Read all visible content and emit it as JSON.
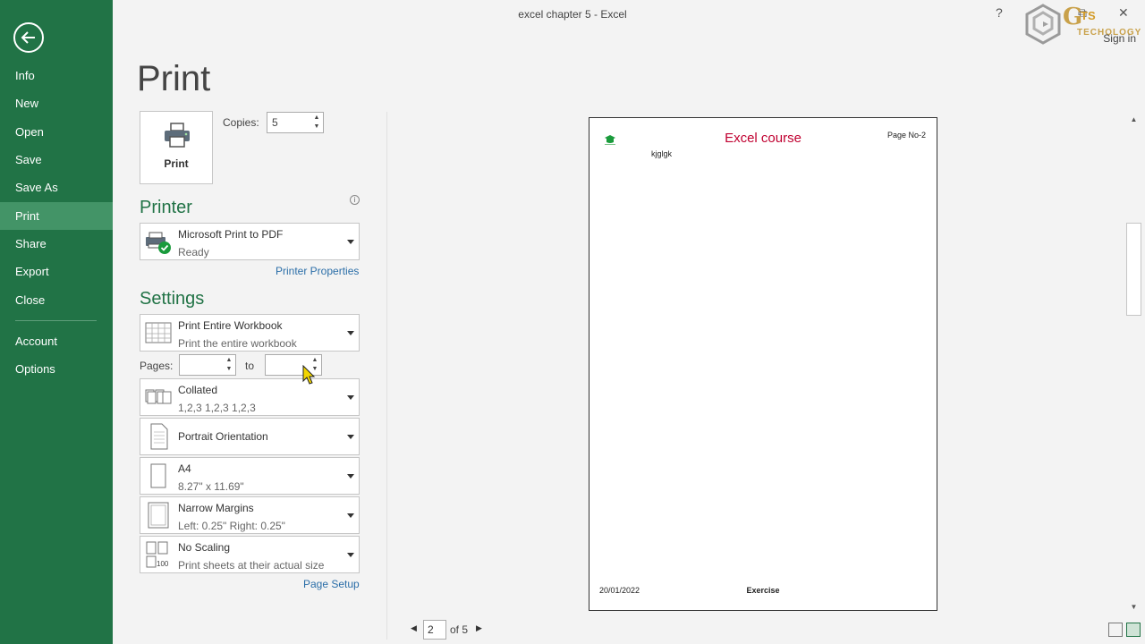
{
  "window": {
    "title": "excel chapter 5 - Excel",
    "help": "?",
    "restore": "⧉",
    "close": "✕",
    "sign_in": "Sign in"
  },
  "logo": {
    "g": "G",
    "ts": "TS",
    "tech": "TECHOLOGY"
  },
  "sidebar": {
    "items": [
      {
        "label": "Info"
      },
      {
        "label": "New"
      },
      {
        "label": "Open"
      },
      {
        "label": "Save"
      },
      {
        "label": "Save As"
      },
      {
        "label": "Print",
        "active": true
      },
      {
        "label": "Share"
      },
      {
        "label": "Export"
      },
      {
        "label": "Close"
      },
      {
        "label": "Account"
      },
      {
        "label": "Options"
      }
    ]
  },
  "main": {
    "title": "Print",
    "print_button": "Print",
    "copies_label": "Copies:",
    "copies_value": "5",
    "printer_heading": "Printer",
    "printer": {
      "name": "Microsoft Print to PDF",
      "status": "Ready"
    },
    "printer_properties": "Printer Properties",
    "settings_heading": "Settings",
    "scope": {
      "title": "Print Entire Workbook",
      "desc": "Print the entire workbook"
    },
    "pages_label": "Pages:",
    "pages_from": "",
    "pages_to_label": "to",
    "pages_to": "",
    "collation": {
      "title": "Collated",
      "desc": "1,2,3    1,2,3    1,2,3"
    },
    "orientation": {
      "title": "Portrait Orientation"
    },
    "paper": {
      "title": "A4",
      "desc": "8.27\" x 11.69\""
    },
    "margins": {
      "title": "Narrow Margins",
      "desc": "Left:  0.25\"    Right:  0.25\""
    },
    "scaling": {
      "title": "No Scaling",
      "desc": "Print sheets at their actual size",
      "icon_text": "100"
    },
    "page_setup": "Page Setup"
  },
  "preview": {
    "header_title": "Excel course",
    "header_page": "Page No-2",
    "cell_text": "kjglgk",
    "footer_date": "20/01/2022",
    "footer_center": "Exercise"
  },
  "page_nav": {
    "current": "2",
    "of": "of 5"
  },
  "colors": {
    "accent": "#217346",
    "active_nav": "#439467",
    "header_red": "#c00030",
    "link": "#2b6ea8"
  }
}
